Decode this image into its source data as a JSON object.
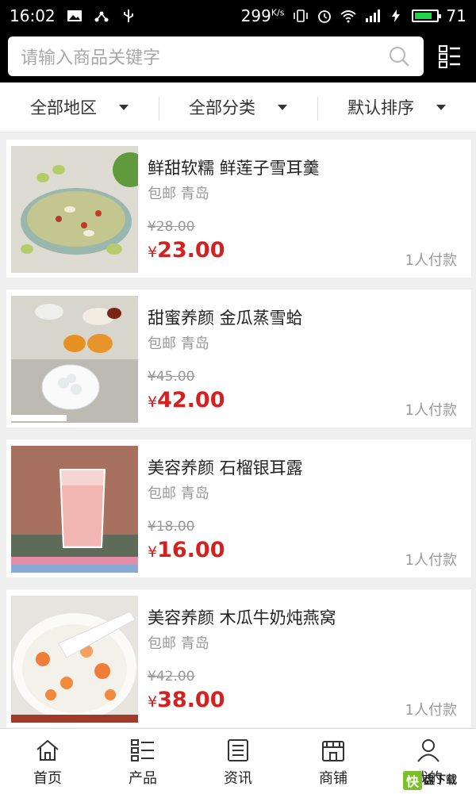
{
  "status_bar": {
    "time": "16:02",
    "speed": "299",
    "speed_unit": "K/s",
    "battery": "71"
  },
  "search": {
    "placeholder": "请输入商品关键字"
  },
  "filters": [
    {
      "label": "全部地区"
    },
    {
      "label": "全部分类"
    },
    {
      "label": "默认排序"
    }
  ],
  "products": [
    {
      "title": "鲜甜软糯 鲜莲子雪耳羹",
      "shipping": "包邮 青岛",
      "old_price": "¥28.00",
      "price_symbol": "¥",
      "price": "23.00",
      "buyers": "1人付款"
    },
    {
      "title": "甜蜜养颜 金瓜蒸雪蛤",
      "shipping": "包邮 青岛",
      "old_price": "¥45.00",
      "price_symbol": "¥",
      "price": "42.00",
      "buyers": "1人付款"
    },
    {
      "title": "美容养颜 石榴银耳露",
      "shipping": "包邮 青岛",
      "old_price": "¥18.00",
      "price_symbol": "¥",
      "price": "16.00",
      "buyers": "1人付款"
    },
    {
      "title": "美容养颜 木瓜牛奶炖燕窝",
      "shipping": "包邮 青岛",
      "old_price": "¥42.00",
      "price_symbol": "¥",
      "price": "38.00",
      "buyers": "1人付款"
    }
  ],
  "tabs": [
    {
      "label": "首页",
      "icon": "home-icon"
    },
    {
      "label": "产品",
      "icon": "list-icon"
    },
    {
      "label": "资讯",
      "icon": "news-icon"
    },
    {
      "label": "商铺",
      "icon": "shop-icon"
    },
    {
      "label": "我的",
      "icon": "user-icon"
    }
  ],
  "watermark": {
    "badge": "快",
    "text": "盘下载"
  },
  "colors": {
    "price": "#d4201f",
    "header": "#000000",
    "accent_green": "#7bbf2a"
  }
}
